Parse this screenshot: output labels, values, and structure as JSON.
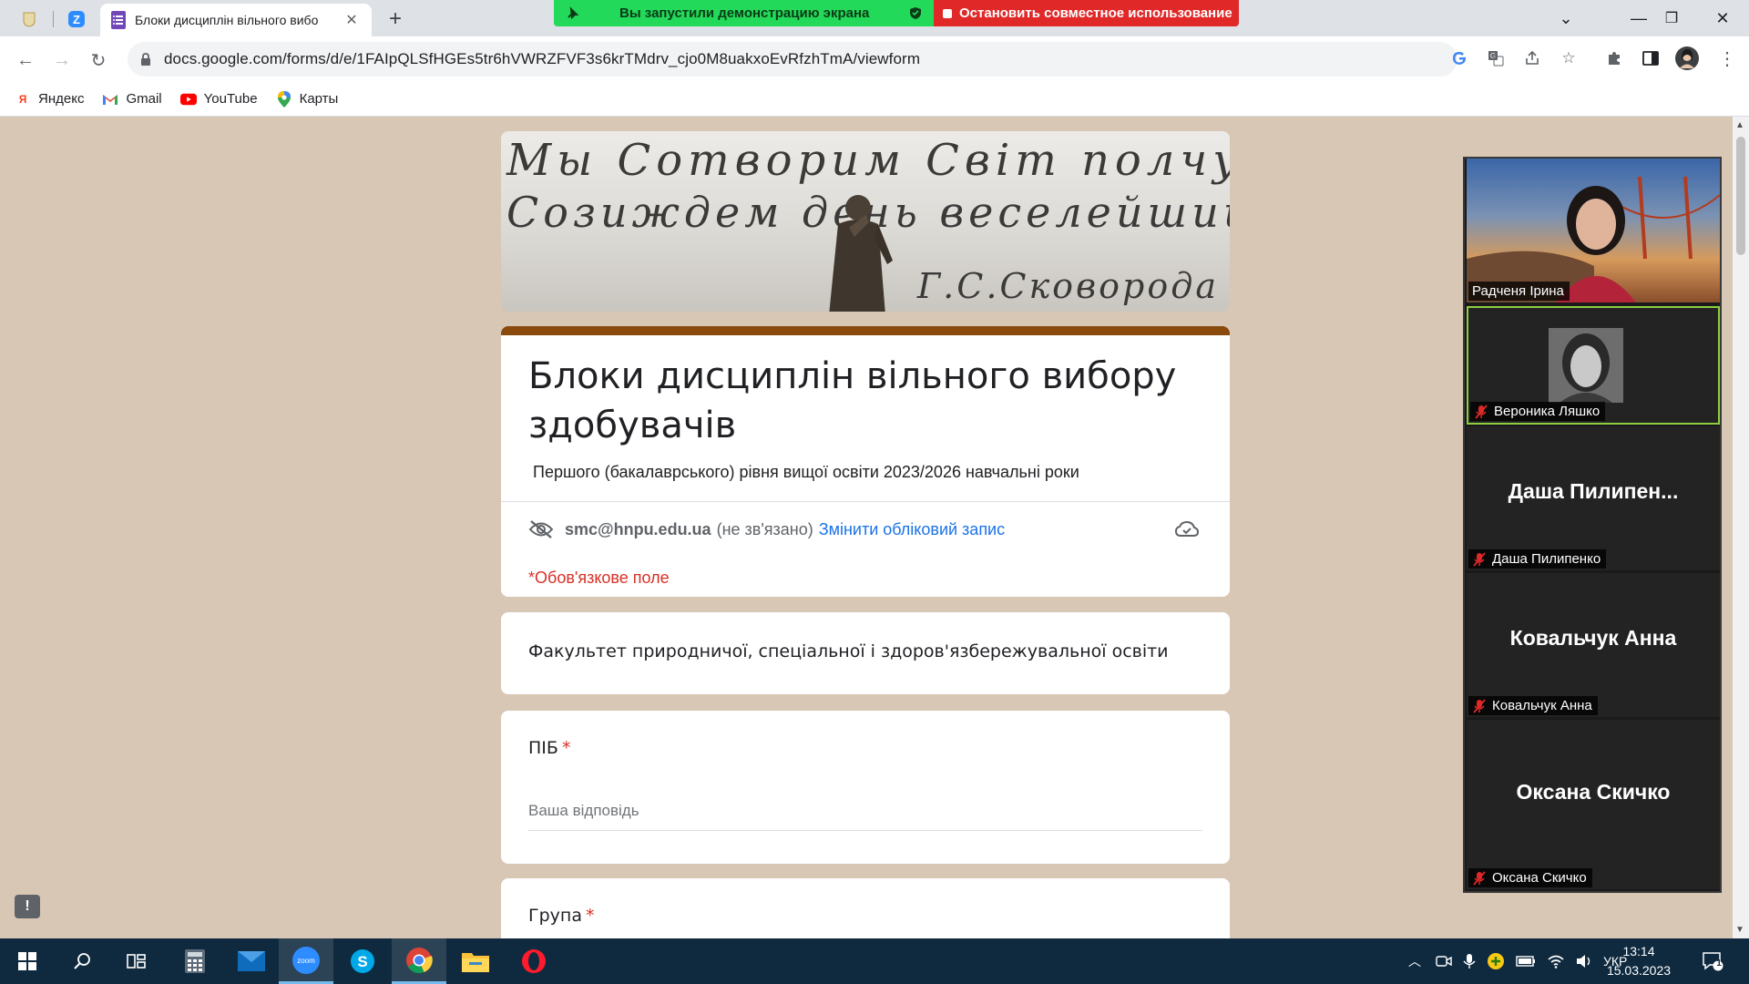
{
  "browser": {
    "active_tab_title": "Блоки дисциплін вільного вибо",
    "url": "docs.google.com/forms/d/e/1FAIpQLSfHGEs5tr6hVWRZFVF3s6krTMdrv_cjo0M8uakxoEvRfzhTmA/viewform",
    "bookmarks": [
      {
        "label": "Яндекс",
        "icon": "yandex-icon"
      },
      {
        "label": "Gmail",
        "icon": "gmail-icon"
      },
      {
        "label": "YouTube",
        "icon": "youtube-icon"
      },
      {
        "label": "Карты",
        "icon": "maps-icon"
      }
    ]
  },
  "screen_share": {
    "status": "Вы запустили демонстрацию экрана",
    "stop": "Остановить совместное использование"
  },
  "banner": {
    "line1": "Мы Сотворим Світ полчущій",
    "line2": "Созиждем день веселейший.",
    "signature": "Г.С.Сковорода"
  },
  "form": {
    "title": "Блоки дисциплін вільного вибору здобувачів",
    "description": "Першого (бакалаврського) рівня вищої освіти 2023/2026 навчальні роки",
    "account_email": "smc@hnpu.edu.ua",
    "account_status": "(не зв'язано)",
    "switch_account": "Змінити обліковий запис",
    "required_note": "*Обов'язкове поле",
    "faculty_text": "Факультет природничої, спеціальної і здоров'язбережувальної освіти",
    "questions": [
      {
        "label": "ПІБ",
        "placeholder": "Ваша відповідь"
      },
      {
        "label": "Група"
      }
    ]
  },
  "zoom": {
    "participants": [
      {
        "name": "Радченя Ірина",
        "video": true
      },
      {
        "name": "Вероника Ляшко",
        "video": true,
        "active_speaker": true,
        "muted": true
      },
      {
        "display": "Даша  Пилипен...",
        "name": "Даша Пилипенко",
        "muted": true
      },
      {
        "display": "Ковальчук Анна",
        "name": "Ковальчук Анна",
        "muted": true
      },
      {
        "display": "Оксана Скичко",
        "name": "Оксана Скичко",
        "muted": true
      }
    ]
  },
  "taskbar": {
    "language": "УКР",
    "time": "13:14",
    "date": "15.03.2023",
    "notification_count": "1"
  },
  "colors": {
    "page_bg": "#d9c7b5",
    "form_accent": "#8a4a0e",
    "required_red": "#d93025",
    "link_blue": "#1a73e8",
    "share_green": "#23d959",
    "share_red": "#e02828"
  }
}
